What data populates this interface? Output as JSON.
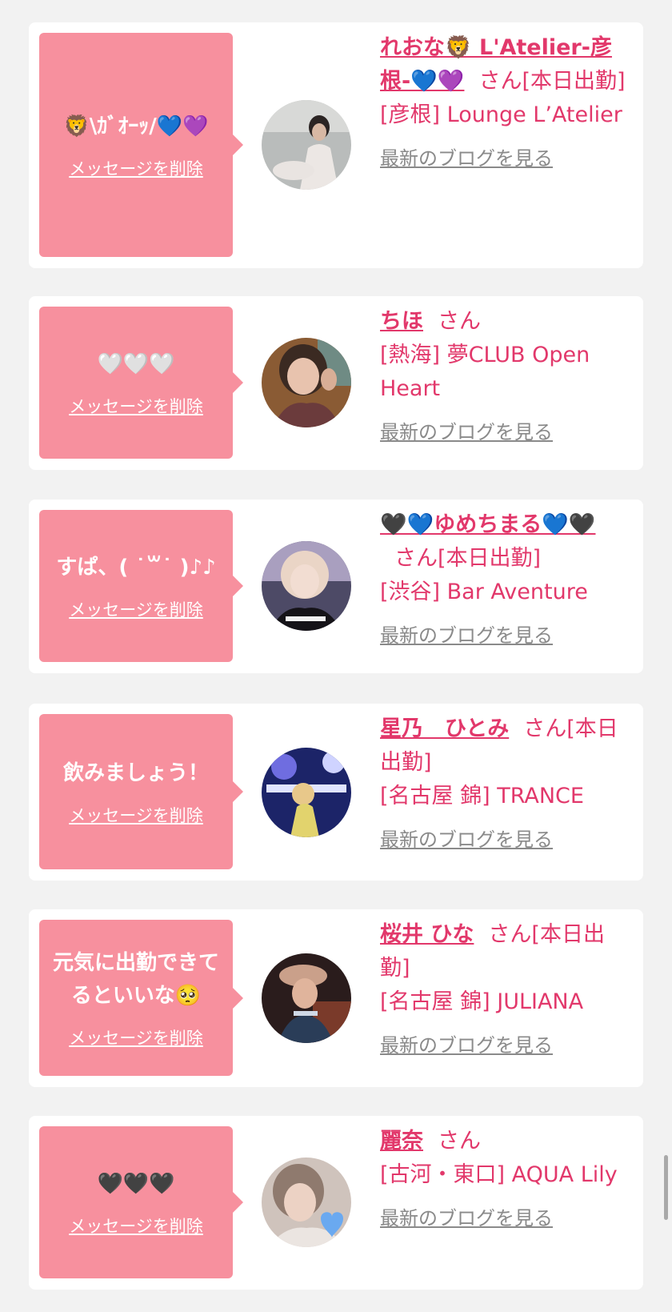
{
  "delete_label": "メッセージを削除",
  "blog_label": "最新のブログを見る",
  "san_label": "さん",
  "cards": [
    {
      "message": "🦁\\ｶﾞｵｰｯ/💙💜",
      "name": "れおな🦁 L'Atelier-彦根-💙💜",
      "status": "[本日出勤]",
      "shop": "[彦根] Lounge L’Atelier"
    },
    {
      "message": "🤍🤍🤍",
      "name": "ちほ",
      "status": "",
      "shop": "[熱海] 夢CLUB Open Heart"
    },
    {
      "message": "すぱ、( ˙꒳˙ )♪♪",
      "name": "🖤💙ゆめちまる💙🖤",
      "status": "[本日出勤]",
      "shop": "[渋谷] Bar Aventure"
    },
    {
      "message": "飲みましょう！",
      "name": "星乃　ひとみ",
      "status": "[本日出勤]",
      "shop": "[名古屋 錦] TRANCE"
    },
    {
      "message": "元気に出勤できてるといいな🥺",
      "name": "桜井 ひな",
      "status": "[本日出勤]",
      "shop": "[名古屋 錦] JULIANA"
    },
    {
      "message": "🖤🖤🖤",
      "name": "麗奈",
      "status": "",
      "shop": "[古河・東口] AQUA Lily"
    }
  ]
}
